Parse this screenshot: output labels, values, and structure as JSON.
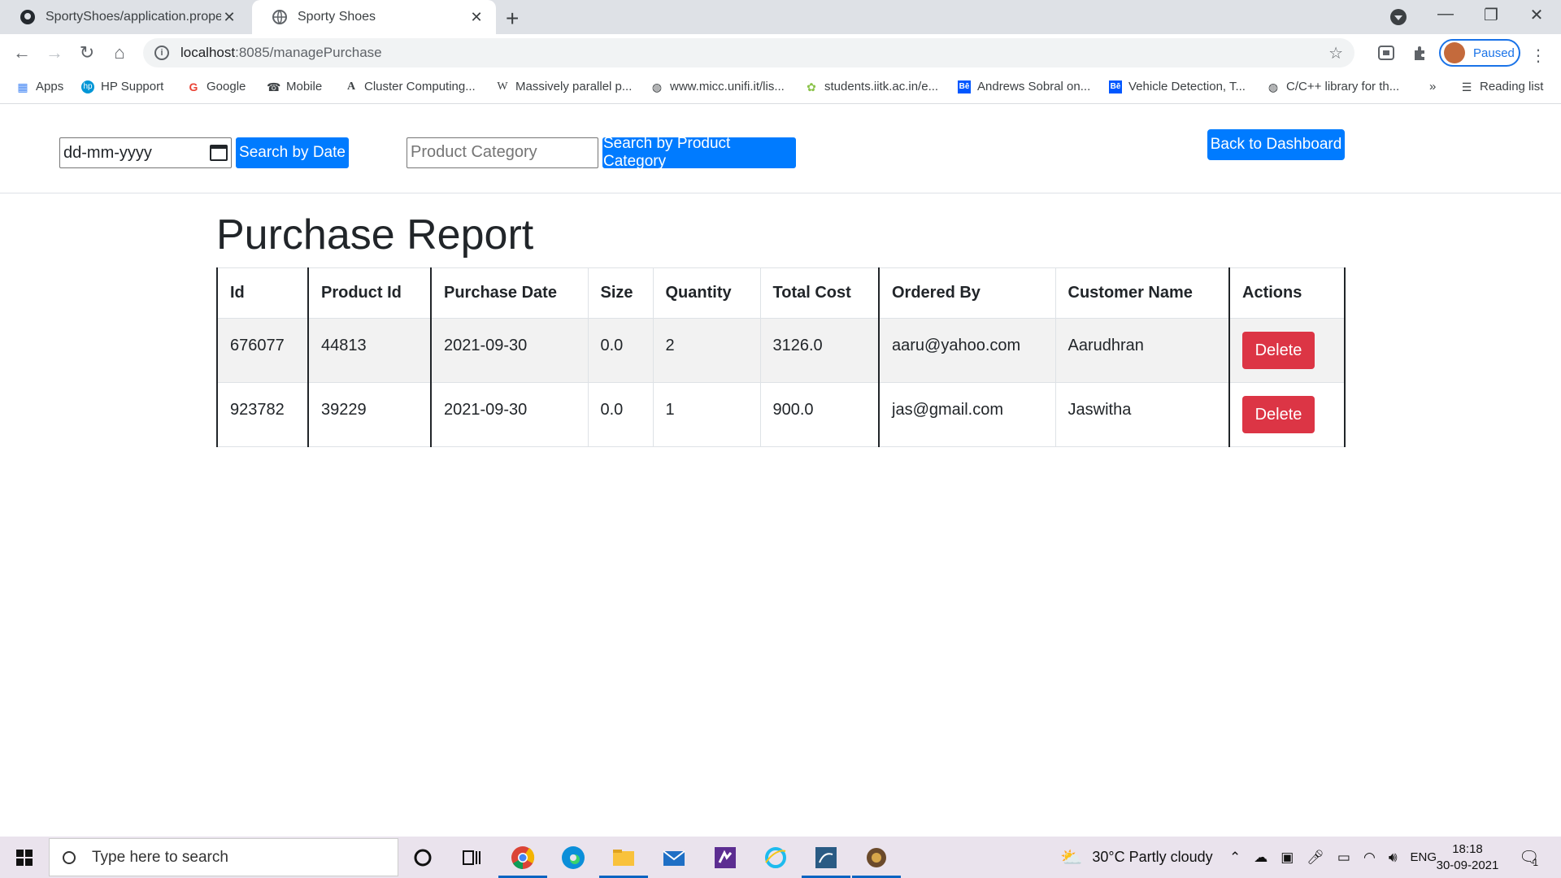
{
  "browser": {
    "tabs": [
      {
        "title": "SportyShoes/application.properti",
        "active": false
      },
      {
        "title": "Sporty Shoes",
        "active": true
      }
    ],
    "address": {
      "host": "localhost",
      "path": ":8085/managePurchase"
    },
    "profile_label": "Paused",
    "bookmarks": [
      {
        "label": "Apps",
        "icon": "apps-grid-icon"
      },
      {
        "label": "HP Support",
        "icon": "hp-icon"
      },
      {
        "label": "Google",
        "icon": "google-icon"
      },
      {
        "label": "Mobile",
        "icon": "mobile-icon"
      },
      {
        "label": "Cluster Computing...",
        "icon": "a-icon"
      },
      {
        "label": "Massively parallel p...",
        "icon": "wikipedia-icon"
      },
      {
        "label": "www.micc.unifi.it/lis...",
        "icon": "globe-icon"
      },
      {
        "label": "students.iitk.ac.in/e...",
        "icon": "leaf-icon"
      },
      {
        "label": "Andrews Sobral on...",
        "icon": "behance-icon"
      },
      {
        "label": "Vehicle Detection, T...",
        "icon": "behance-icon"
      },
      {
        "label": "C/C++ library for th...",
        "icon": "globe-icon"
      }
    ],
    "more_bookmarks": "»",
    "reading_list": "Reading list"
  },
  "filters": {
    "date_placeholder": "dd-mm-yyyy",
    "search_date_label": "Search by Date",
    "category_placeholder": "Product Category",
    "search_category_label": "Search by Product Category",
    "dashboard_label": "Back to Dashboard"
  },
  "report": {
    "title": "Purchase Report",
    "columns": [
      "Id",
      "Product Id",
      "Purchase Date",
      "Size",
      "Quantity",
      "Total Cost",
      "Ordered By",
      "Customer Name",
      "Actions"
    ],
    "rows": [
      {
        "id": "676077",
        "product_id": "44813",
        "date": "2021-09-30",
        "size": "0.0",
        "quantity": "2",
        "total": "3126.0",
        "ordered_by": "aaru@yahoo.com",
        "customer": "Aarudhran",
        "action": "Delete"
      },
      {
        "id": "923782",
        "product_id": "39229",
        "date": "2021-09-30",
        "size": "0.0",
        "quantity": "1",
        "total": "900.0",
        "ordered_by": "jas@gmail.com",
        "customer": "Jaswitha",
        "action": "Delete"
      }
    ]
  },
  "taskbar": {
    "search_placeholder": "Type here to search",
    "weather": "30°C  Partly cloudy",
    "language": "ENG",
    "time": "18:18",
    "date": "30-09-2021",
    "notification_count": "1"
  },
  "colors": {
    "primary": "#007bff",
    "danger": "#dc3545",
    "chrome_tab_bg": "#dee1e6"
  }
}
